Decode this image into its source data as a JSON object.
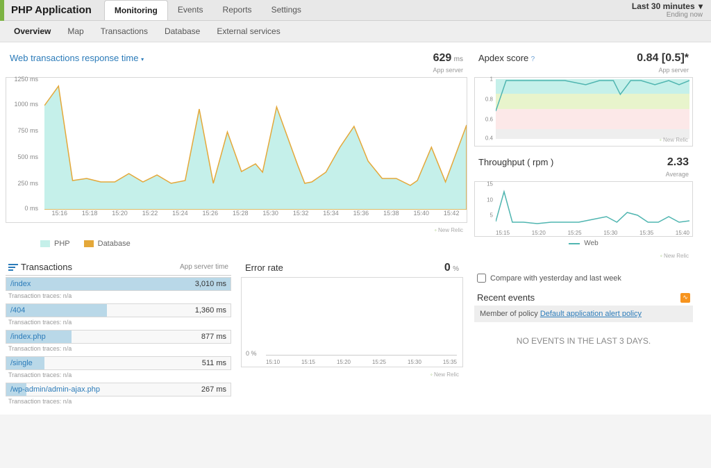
{
  "app_title": "PHP Application",
  "main_tabs": [
    "Monitoring",
    "Events",
    "Reports",
    "Settings"
  ],
  "active_main_tab": 0,
  "time_range": {
    "label": "Last 30 minutes",
    "sub": "Ending now"
  },
  "sub_nav": [
    "Overview",
    "Map",
    "Transactions",
    "Database",
    "External services"
  ],
  "active_sub_nav": 0,
  "response_time": {
    "title": "Web transactions response time",
    "value": "629",
    "unit": "ms",
    "sub": "App server",
    "y_ticks": [
      "1250 ms",
      "1000 ms",
      "750 ms",
      "500 ms",
      "250 ms",
      "0 ms"
    ],
    "x_ticks": [
      "15:16",
      "15:18",
      "15:20",
      "15:22",
      "15:24",
      "15:26",
      "15:28",
      "15:30",
      "15:32",
      "15:34",
      "15:36",
      "15:38",
      "15:40",
      "15:42"
    ],
    "legend": [
      {
        "label": "PHP",
        "color": "#c5f0ea"
      },
      {
        "label": "Database",
        "color": "#e4a83a"
      }
    ],
    "brand": "New Relic"
  },
  "apdex": {
    "title": "Apdex score",
    "value": "0.84",
    "bracket": "[0.5]*",
    "sub": "App server",
    "y_ticks": [
      "1",
      "0.8",
      "0.6",
      "0.4"
    ],
    "brand": "New Relic"
  },
  "throughput": {
    "title": "Throughput ( rpm )",
    "value": "2.33",
    "sub": "Average",
    "y_ticks": [
      "15",
      "10",
      "5"
    ],
    "x_ticks": [
      "15:15",
      "15:20",
      "15:25",
      "15:30",
      "15:35",
      "15:40"
    ],
    "legend_label": "Web",
    "brand": "New Relic"
  },
  "compare_label": "Compare with yesterday and last week",
  "transactions": {
    "title": "Transactions",
    "right_label": "App server time",
    "trace_label": "Transaction traces: n/a",
    "rows": [
      {
        "name": "/index",
        "value": "3,010 ms",
        "width": 100
      },
      {
        "name": "/404",
        "value": "1,360 ms",
        "width": 45
      },
      {
        "name": "/index.php",
        "value": "877 ms",
        "width": 29
      },
      {
        "name": "/single",
        "value": "511 ms",
        "width": 17
      },
      {
        "name": "/wp-admin/admin-ajax.php",
        "value": "267 ms",
        "width": 9
      }
    ]
  },
  "error_rate": {
    "title": "Error rate",
    "value": "0",
    "unit": "%",
    "y0": "0 %",
    "x_ticks": [
      "15:10",
      "15:15",
      "15:20",
      "15:25",
      "15:30",
      "15:35"
    ],
    "brand": "New Relic"
  },
  "recent_events": {
    "title": "Recent events",
    "policy_prefix": "Member of policy ",
    "policy_link": "Default application alert policy",
    "empty": "NO EVENTS IN THE LAST 3 DAYS."
  },
  "chart_data": [
    {
      "type": "area",
      "title": "Web transactions response time",
      "x": [
        "15:16",
        "15:18",
        "15:20",
        "15:22",
        "15:24",
        "15:26",
        "15:28",
        "15:30",
        "15:32",
        "15:34",
        "15:36",
        "15:38",
        "15:40",
        "15:42"
      ],
      "series": [
        {
          "name": "PHP",
          "values": [
            1000,
            1180,
            280,
            300,
            360,
            260,
            320,
            250,
            960,
            250,
            750,
            380,
            440,
            360,
            980,
            440,
            250,
            280,
            360,
            600,
            800,
            480,
            300,
            320,
            240,
            280,
            600,
            280,
            800
          ]
        },
        {
          "name": "Database",
          "values_note": "thin orange line tracing top of PHP area"
        }
      ],
      "ylabel": "ms",
      "ylim": [
        0,
        1250
      ]
    },
    {
      "type": "line",
      "title": "Apdex score",
      "ylim": [
        0.4,
        1.0
      ],
      "bands": [
        {
          "range": [
            0.85,
            1.0
          ],
          "color": "#c5f0ea"
        },
        {
          "range": [
            0.7,
            0.85
          ],
          "color": "#e8f4cc"
        },
        {
          "range": [
            0.5,
            0.7
          ],
          "color": "#fce8e8"
        }
      ],
      "series": [
        {
          "name": "apdex",
          "values": [
            0.68,
            1,
            1,
            1,
            1,
            1,
            1,
            1,
            0.95,
            1,
            1,
            0.85,
            1,
            1,
            0.95,
            1,
            0.95
          ]
        }
      ]
    },
    {
      "type": "line",
      "title": "Throughput (rpm)",
      "x": [
        "15:15",
        "15:20",
        "15:25",
        "15:30",
        "15:35",
        "15:40"
      ],
      "series": [
        {
          "name": "Web",
          "values": [
            12,
            2,
            2,
            1,
            2,
            2,
            2,
            2,
            3,
            4,
            2,
            5,
            4,
            2,
            2,
            4,
            2
          ]
        }
      ],
      "ylim": [
        0,
        15
      ],
      "ylabel": "rpm"
    },
    {
      "type": "line",
      "title": "Error rate",
      "x": [
        "15:10",
        "15:15",
        "15:20",
        "15:25",
        "15:30",
        "15:35"
      ],
      "series": [
        {
          "name": "error",
          "values": [
            0,
            0,
            0,
            0,
            0,
            0
          ]
        }
      ],
      "ylim": [
        0,
        1
      ],
      "ylabel": "%"
    }
  ]
}
